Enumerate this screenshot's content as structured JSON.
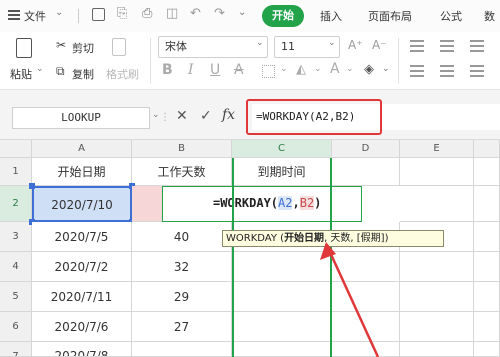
{
  "menubar": {
    "file_label": "文件",
    "tabs": [
      "开始",
      "插入",
      "页面布局",
      "公式",
      "数"
    ]
  },
  "ribbon": {
    "paste_label": "粘贴",
    "cut_label": "剪切",
    "copy_label": "复制",
    "format_painter_label": "格式刷",
    "font_name": "宋体",
    "font_size": "11",
    "font_size_up": "A⁺",
    "font_size_down": "A⁻"
  },
  "formula_bar": {
    "name_box": "LOOKUP",
    "cancel_glyph": "✕",
    "enter_glyph": "✓",
    "fx_label": "fx",
    "formula": "=WORKDAY(A2,B2)"
  },
  "sheet": {
    "columns": [
      "A",
      "B",
      "C",
      "D",
      "E"
    ],
    "row_numbers": [
      "1",
      "2",
      "3",
      "4",
      "5",
      "6",
      "7"
    ],
    "headers": [
      "开始日期",
      "工作天数",
      "到期时间"
    ],
    "rows": [
      {
        "start": "2020/7/10",
        "days": "",
        "due": ""
      },
      {
        "start": "2020/7/5",
        "days": "40",
        "due": ""
      },
      {
        "start": "2020/7/2",
        "days": "32",
        "due": ""
      },
      {
        "start": "2020/7/11",
        "days": "29",
        "due": ""
      },
      {
        "start": "2020/7/6",
        "days": "27",
        "due": ""
      },
      {
        "start": "2020/7/8",
        "days": "",
        "due": ""
      }
    ],
    "editing_formula": {
      "prefix": "=WORKDAY(",
      "ref1": "A2",
      "sep": ",",
      "ref2": "B2",
      "suffix": ")"
    },
    "tooltip": {
      "func": "WORKDAY",
      "open": " (",
      "arg1": "开始日期",
      "rest": ", 天数, [假期])"
    }
  },
  "colors": {
    "accent_green": "#22a34a",
    "highlight_red": "#e0383a",
    "ref_blue": "#3d6fd4",
    "ref_red": "#e57373"
  }
}
